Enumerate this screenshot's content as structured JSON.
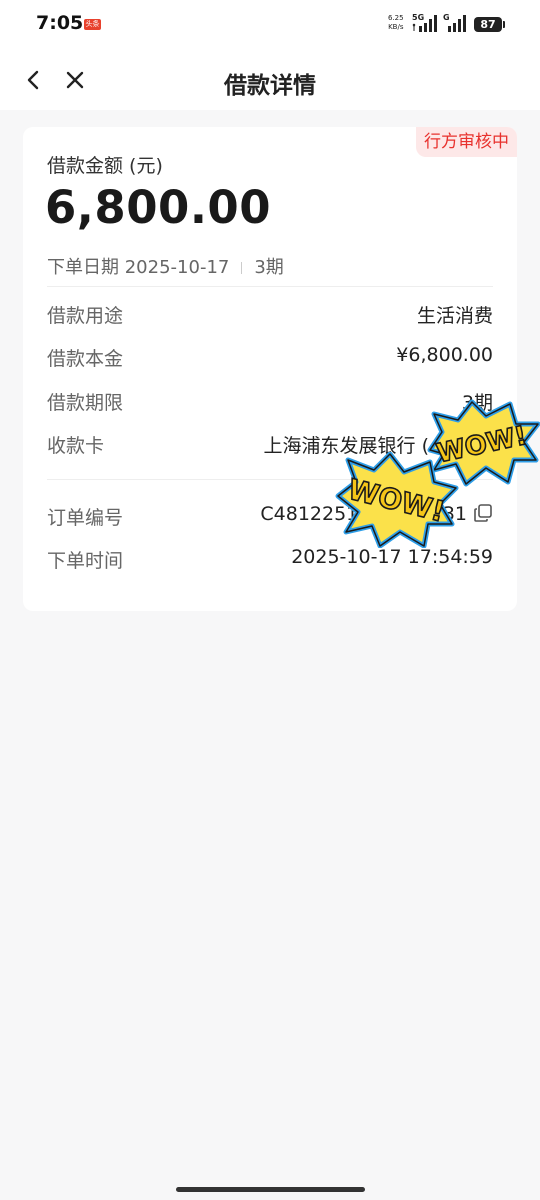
{
  "status_bar": {
    "time": "7:05",
    "notification_badge": "头条",
    "net_speed_value": "6.25",
    "net_speed_unit": "KB/s",
    "signal1_label": "5G",
    "signal2_label": "G",
    "battery": "87"
  },
  "nav": {
    "title": "借款详情",
    "back_icon": "chevron-left-icon",
    "close_icon": "close-icon"
  },
  "summary": {
    "status_tag": "行方审核中",
    "amount_label": "借款金额 (元)",
    "amount": "6,800.00",
    "order_date_label": "下单日期",
    "order_date": "2025-10-17",
    "periods": "3期"
  },
  "details": [
    {
      "label": "借款用途",
      "value": "生活消费"
    },
    {
      "label": "借款本金",
      "value": "¥6,800.00"
    },
    {
      "label": "借款期限",
      "value": "3期"
    },
    {
      "label": "收款卡",
      "value": "上海浦东发展银行 ("
    }
  ],
  "order": [
    {
      "label": "订单编号",
      "value": "C48122515            31"
    },
    {
      "label": "下单时间",
      "value": "2025-10-17 17:54:59"
    }
  ],
  "stickers": {
    "text": "WOW!"
  },
  "colors": {
    "accent_red": "#e8312d",
    "tag_bg": "#fde8e8",
    "sticker_yellow": "#f5c518",
    "sticker_blue": "#2e9ee8"
  }
}
